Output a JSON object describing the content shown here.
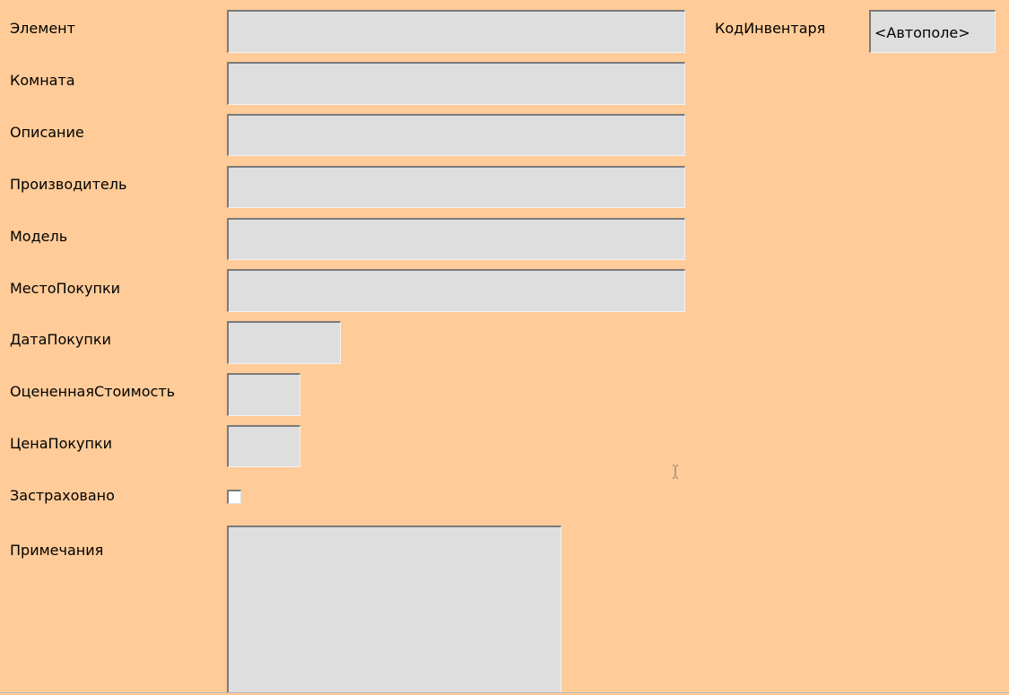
{
  "form": {
    "fields": [
      {
        "label": "Элемент",
        "value": ""
      },
      {
        "label": "Комната",
        "value": ""
      },
      {
        "label": "Описание",
        "value": ""
      },
      {
        "label": "Производитель",
        "value": ""
      },
      {
        "label": "Модель",
        "value": ""
      },
      {
        "label": "МестоПокупки",
        "value": ""
      },
      {
        "label": "ДатаПокупки",
        "value": ""
      },
      {
        "label": "ОцененнаяСтоимость",
        "value": ""
      },
      {
        "label": "ЦенаПокупки",
        "value": ""
      },
      {
        "label": "Застраховано",
        "checked": false
      },
      {
        "label": "Примечания",
        "value": ""
      }
    ],
    "id_field": {
      "label": "КодИнвентаря",
      "value": "<Автополе>"
    }
  },
  "colors": {
    "background": "#FFCB98",
    "field_background": "#DEDEDE"
  },
  "cursor": "text-cursor-icon"
}
